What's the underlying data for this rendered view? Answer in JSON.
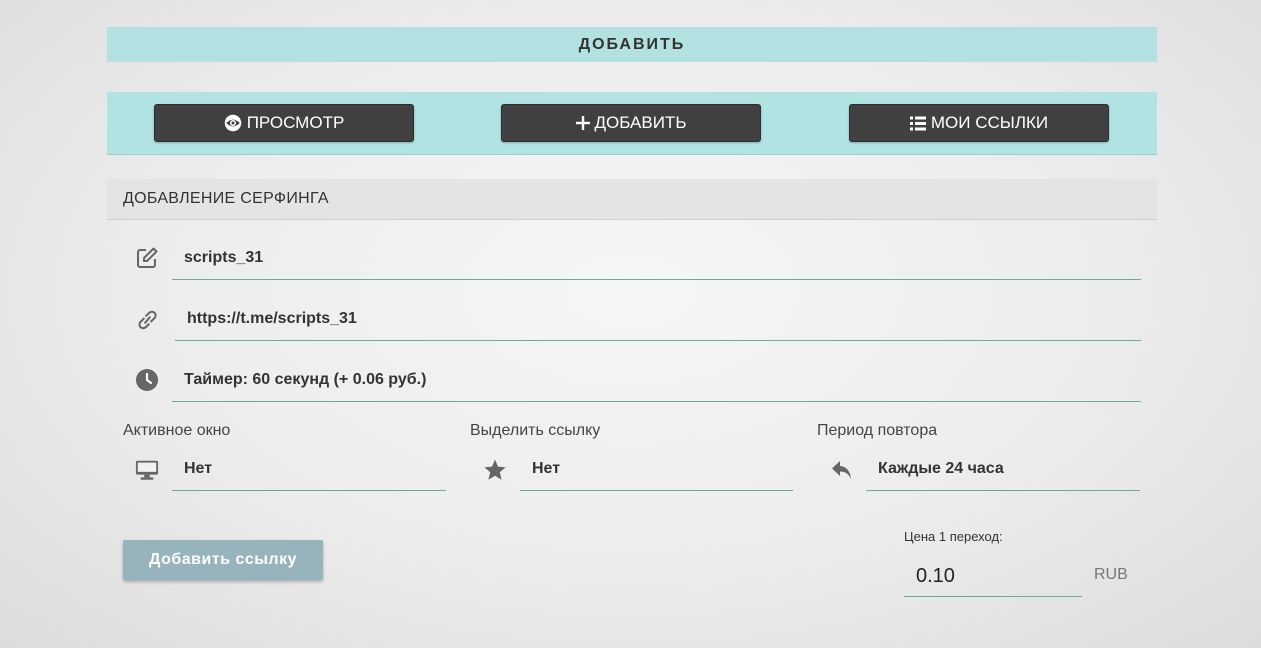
{
  "header": {
    "title": "ДОБАВИТЬ"
  },
  "nav": {
    "view_label": "ПРОСМОТР",
    "add_label": "ДОБАВИТЬ",
    "links_label": "МОИ ССЫЛКИ"
  },
  "section": {
    "title": "ДОБАВЛЕНИЕ СЕРФИНГА"
  },
  "form": {
    "name_value": "scripts_31",
    "url_value": "https://t.me/scripts_31",
    "timer_value": "Таймер: 60 секунд (+ 0.06 руб.)",
    "active_window": {
      "label": "Активное окно",
      "value": "Нет"
    },
    "highlight": {
      "label": "Выделить ссылку",
      "value": "Нет"
    },
    "repeat": {
      "label": "Период повтора",
      "value": "Каждые 24 часа"
    },
    "submit_label": "Добавить ссылку",
    "price": {
      "label": "Цена 1 переход:",
      "value": "0.10",
      "currency": "RUB"
    }
  },
  "colors": {
    "accent_bar": "#b3e1e1",
    "nav_button": "#404040",
    "submit_button": "#97b4bc",
    "underline": "#6fa6a0"
  }
}
